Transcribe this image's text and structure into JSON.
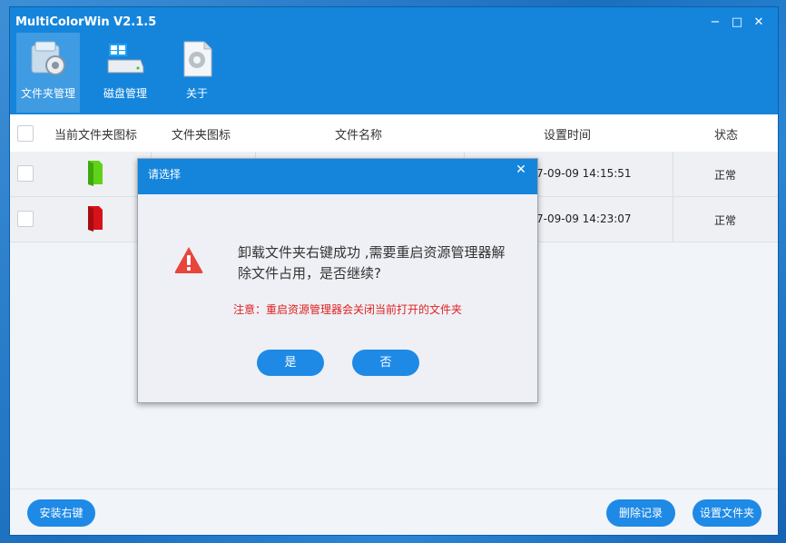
{
  "app": {
    "title": "MultiColorWin V2.1.5"
  },
  "window_controls": {
    "minimize": "−",
    "maximize": "□",
    "close": "✕"
  },
  "toolbar": {
    "items": [
      {
        "label": "文件夹管理",
        "icon": "folder-settings-icon",
        "active": true
      },
      {
        "label": "磁盘管理",
        "icon": "disk-drive-icon",
        "active": false
      },
      {
        "label": "关于",
        "icon": "gear-document-icon",
        "active": false
      }
    ]
  },
  "table": {
    "headers": [
      "当前文件夹图标",
      "文件夹图标",
      "文件名称",
      "设置时间",
      "状态"
    ],
    "rows": [
      {
        "folder_color": "#5fd31a",
        "time": "7-09-09 14:15:51",
        "status": "正常"
      },
      {
        "folder_color": "#d8121a",
        "time": "7-09-09 14:23:07",
        "status": "正常"
      }
    ]
  },
  "bottom": {
    "install_label": "安装右键",
    "delete_label": "删除记录",
    "set_label": "设置文件夹"
  },
  "dialog": {
    "title": "请选择",
    "close": "✕",
    "message": "卸载文件夹右键成功 ,需要重启资源管理器解除文件占用，是否继续?",
    "note": "注意：重启资源管理器会关闭当前打开的文件夹",
    "yes_label": "是",
    "no_label": "否",
    "icon": "warning-icon",
    "warning_color": "#e8453c"
  },
  "colors": {
    "accent": "#1585dc",
    "button": "#1e8ae6",
    "note": "#e02020"
  }
}
